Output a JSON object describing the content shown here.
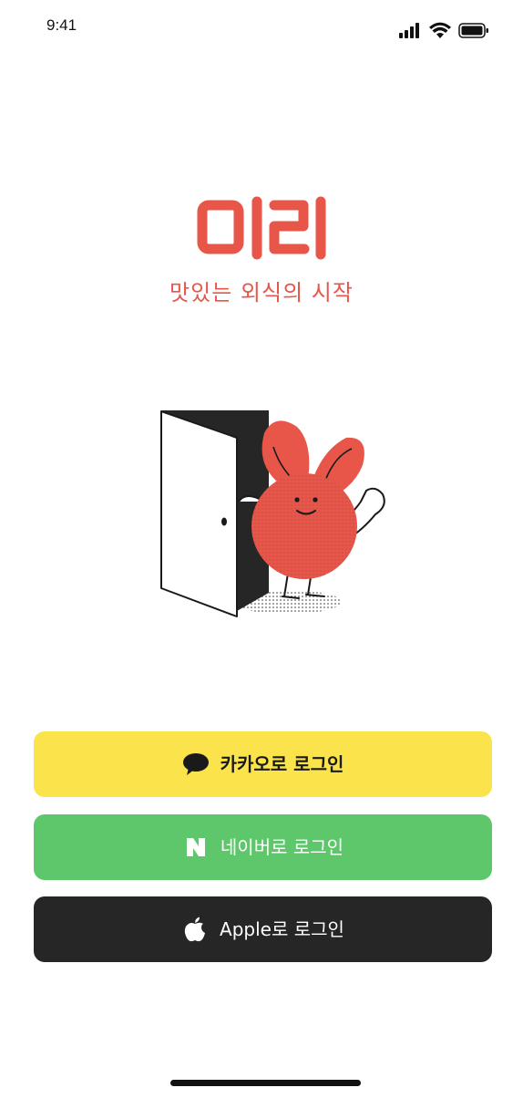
{
  "status_bar": {
    "time": "9:41",
    "icons": [
      "signal-icon",
      "wifi-icon",
      "battery-icon"
    ]
  },
  "brand": {
    "logo_text": "미리",
    "tagline": "맛있는 외식의 시작",
    "accent_color": "#e8564a"
  },
  "login": {
    "kakao": {
      "label": "카카오로 로그인",
      "icon": "kakao-chat-bubble-icon",
      "color": "#fae34b"
    },
    "naver": {
      "label": "네이버로 로그인",
      "icon": "naver-n-icon",
      "color": "#5ec76b"
    },
    "apple": {
      "label": "Apple로 로그인",
      "icon": "apple-icon",
      "color": "#262626"
    }
  }
}
